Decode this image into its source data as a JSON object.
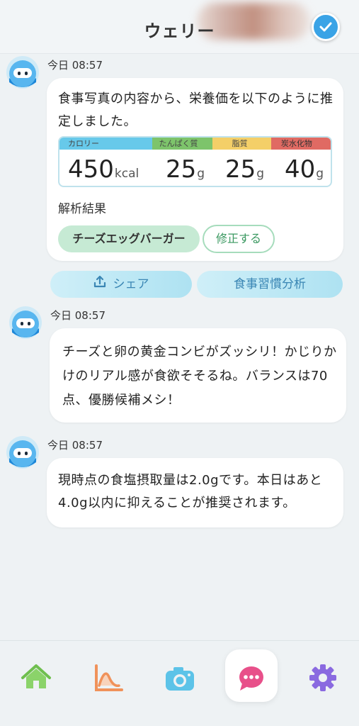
{
  "header": {
    "title": "ウェリー"
  },
  "messages": [
    {
      "time": "今日 08:57",
      "text": "食事写真の内容から、栄養価を以下のように推定しました。",
      "nutrition": {
        "headers": {
          "calories": "カロリー",
          "protein": "たんぱく質",
          "fat": "脂質",
          "carbs": "炭水化物"
        },
        "values": {
          "calories": "450",
          "protein": "25",
          "fat": "25",
          "carbs": "40"
        },
        "units": {
          "calories": "kcal",
          "protein": "g",
          "fat": "g",
          "carbs": "g"
        }
      },
      "analysis_label": "解析結果",
      "food_tag": "チーズエッグバーガー",
      "edit_label": "修正する"
    },
    {
      "time": "今日 08:57",
      "text": "チーズと卵の黄金コンビがズッシリ！かじりかけのリアル感が食欲そそるね。バランスは70点、優勝候補メシ！"
    },
    {
      "time": "今日 08:57",
      "text": "現時点の食塩摂取量は2.0gです。本日はあと4.0g以内に抑えることが推奨されます。"
    }
  ],
  "actions": {
    "share_label": "シェア",
    "habit_label": "食事習慣分析"
  },
  "nav": {
    "items": [
      "home-icon",
      "chart-icon",
      "camera-icon",
      "chat-icon",
      "settings-icon"
    ],
    "active": "chat-icon"
  },
  "colors": {
    "accent_blue": "#3aa3e6",
    "calories": "#67c9ea",
    "protein": "#7dc46b",
    "fat": "#f4cf68",
    "carbs": "#e06a63",
    "home": "#8bd36a",
    "chart": "#f0925a",
    "camera": "#5cc3e8",
    "chat": "#e8508a",
    "settings": "#8a6ae0"
  }
}
